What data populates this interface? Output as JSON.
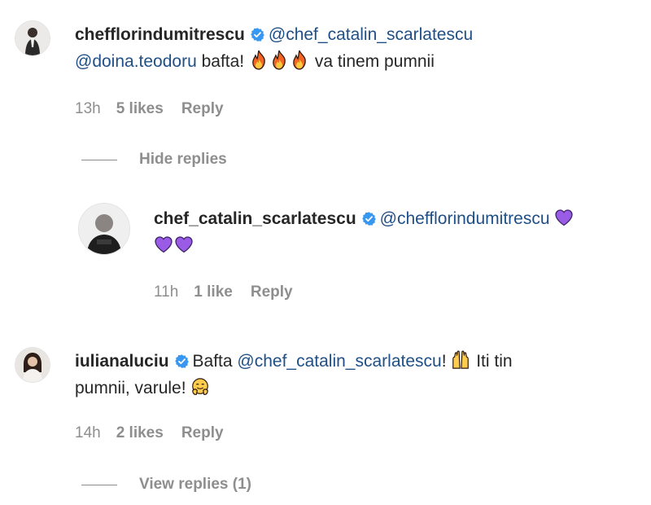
{
  "comments": [
    {
      "username": "chefflorindumitrescu",
      "verified": true,
      "text_line1_mention": "@chef_catalin_scarlatescu",
      "text_line2_mention": "@doina.teodoru",
      "text_line2_rest": " bafta! ",
      "emoji": [
        "fire-emoji",
        "fire-emoji",
        "fire-emoji"
      ],
      "text_line2_tail": " va tinem pumnii",
      "time": "13h",
      "likes": "5 likes",
      "reply_label": "Reply",
      "replies_toggle": "Hide replies"
    },
    {
      "username": "chef_catalin_scarlatescu",
      "verified": true,
      "mention": "@chefflorindumitrescu",
      "emoji": [
        "purple-heart-emoji",
        "purple-heart-emoji",
        "purple-heart-emoji"
      ],
      "time": "11h",
      "likes": "1 like",
      "reply_label": "Reply"
    },
    {
      "username": "iulianaluciu",
      "verified": true,
      "text_before": "Bafta ",
      "mention": "@chef_catalin_scarlatescu",
      "text_after": "! ",
      "emoji_1": "raising-hands-emoji",
      "text_mid": " Iti tin",
      "text_line2": "pumnii, varule! ",
      "emoji_2": "hugging-face-emoji",
      "time": "14h",
      "likes": "2 likes",
      "reply_label": "Reply",
      "replies_toggle": "View replies (1)"
    }
  ],
  "colors": {
    "mention": "#1f4f87",
    "muted": "#8e8e8e",
    "verified": "#3897f0",
    "purple_heart": "#9a5ce6",
    "fire": "#f26522"
  }
}
